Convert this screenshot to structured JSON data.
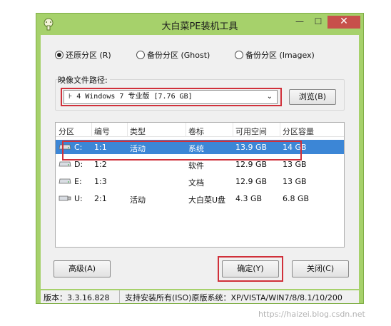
{
  "window": {
    "title": "大白菜PE装机工具",
    "min_glyph": "—",
    "max_glyph": "☐",
    "close_glyph": "✕"
  },
  "restore_options": [
    {
      "label": "还原分区 (R)",
      "selected": true
    },
    {
      "label": "备份分区 (Ghost)",
      "selected": false
    },
    {
      "label": "备份分区 (Imagex)",
      "selected": false
    }
  ],
  "image_path": {
    "label": "映像文件路径:",
    "value": "⊦ 4 Windows 7 专业版 [7.76 GB]",
    "browse_label": "浏览(B)"
  },
  "partition_table": {
    "columns": [
      "分区",
      "编号",
      "类型",
      "卷标",
      "可用空间",
      "分区容量"
    ],
    "rows": [
      {
        "drive": "C:",
        "number": "1:1",
        "type": "活动",
        "label": "系统",
        "free": "13.9 GB",
        "capacity": "14 GB",
        "selected": true,
        "icon": "hdd-icon"
      },
      {
        "drive": "D:",
        "number": "1:2",
        "type": "",
        "label": "软件",
        "free": "12.9 GB",
        "capacity": "13 GB",
        "selected": false,
        "icon": "hdd-icon"
      },
      {
        "drive": "E:",
        "number": "1:3",
        "type": "",
        "label": "文档",
        "free": "12.9 GB",
        "capacity": "13 GB",
        "selected": false,
        "icon": "hdd-icon"
      },
      {
        "drive": "U:",
        "number": "2:1",
        "type": "活动",
        "label": "大白菜U盘",
        "free": "4.3 GB",
        "capacity": "6.8 GB",
        "selected": false,
        "icon": "usb-drive-icon"
      }
    ]
  },
  "buttons": {
    "advanced": "高级(A)",
    "ok": "确定(Y)",
    "close": "关闭(C)"
  },
  "status": {
    "version": "版本：3.3.16.828",
    "support": "支持安装所有(ISO)原版系统：XP/VISTA/WIN7/8/8.1/10/200"
  },
  "watermark": "https://haizei.blog.csdn.net",
  "colors": {
    "titlebar": "#a6d16b",
    "close_button": "#c7504b",
    "selection": "#3c86d6",
    "highlight_box": "#d0303a"
  }
}
